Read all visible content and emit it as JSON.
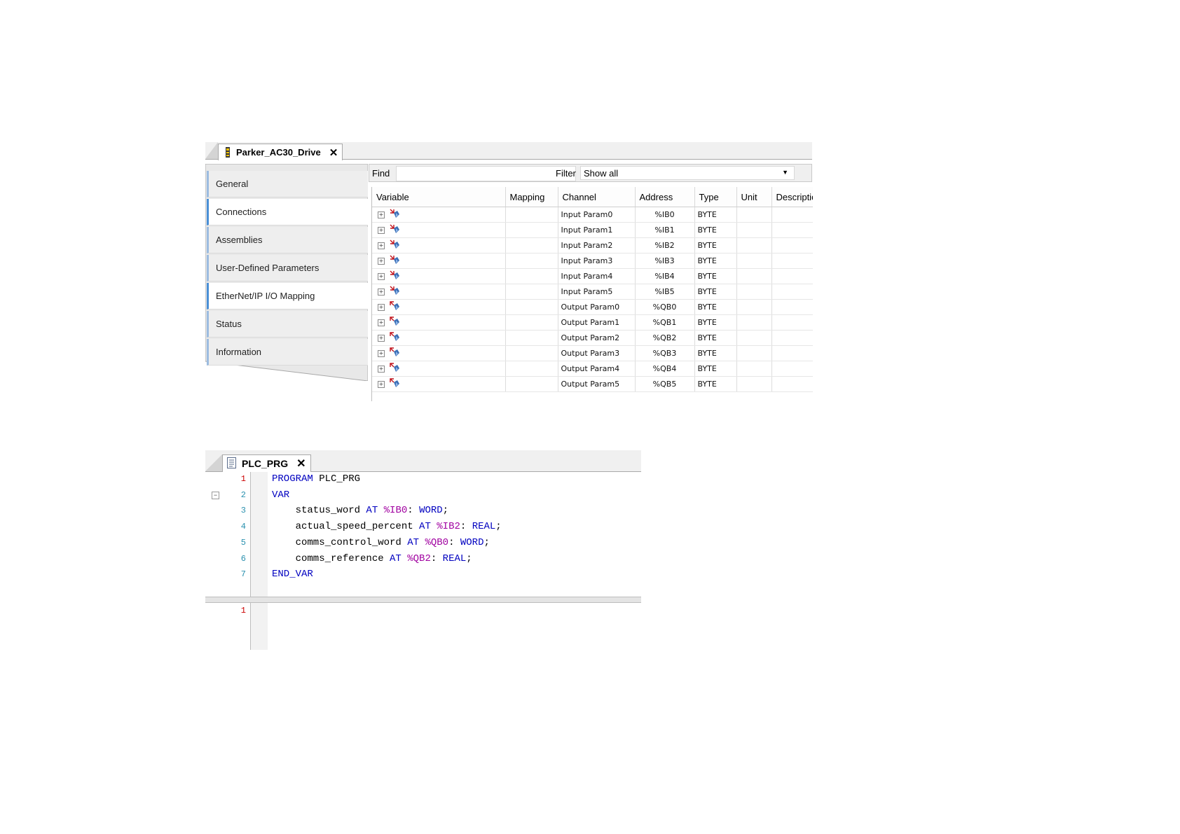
{
  "device_editor": {
    "tab_title": "Parker_AC30_Drive",
    "close_glyph": "✕",
    "nav_items": [
      {
        "label": "General",
        "active": false
      },
      {
        "label": "Connections",
        "active": true
      },
      {
        "label": "Assemblies",
        "active": false
      },
      {
        "label": "User-Defined Parameters",
        "active": false
      },
      {
        "label": "EtherNet/IP I/O Mapping",
        "active": true
      },
      {
        "label": "Status",
        "active": false
      },
      {
        "label": "Information",
        "active": false
      }
    ],
    "find_label": "Find",
    "find_value": "",
    "filter_label": "Filter",
    "filter_value": "Show all",
    "columns": [
      "Variable",
      "Mapping",
      "Channel",
      "Address",
      "Type",
      "Unit",
      "Description"
    ],
    "rows": [
      {
        "channel": "Input Param0",
        "address": "%IB0",
        "type": "BYTE",
        "direction": "input"
      },
      {
        "channel": "Input Param1",
        "address": "%IB1",
        "type": "BYTE",
        "direction": "input"
      },
      {
        "channel": "Input Param2",
        "address": "%IB2",
        "type": "BYTE",
        "direction": "input"
      },
      {
        "channel": "Input Param3",
        "address": "%IB3",
        "type": "BYTE",
        "direction": "input"
      },
      {
        "channel": "Input Param4",
        "address": "%IB4",
        "type": "BYTE",
        "direction": "input"
      },
      {
        "channel": "Input Param5",
        "address": "%IB5",
        "type": "BYTE",
        "direction": "input"
      },
      {
        "channel": "Output Param0",
        "address": "%QB0",
        "type": "BYTE",
        "direction": "output"
      },
      {
        "channel": "Output Param1",
        "address": "%QB1",
        "type": "BYTE",
        "direction": "output"
      },
      {
        "channel": "Output Param2",
        "address": "%QB2",
        "type": "BYTE",
        "direction": "output"
      },
      {
        "channel": "Output Param3",
        "address": "%QB3",
        "type": "BYTE",
        "direction": "output"
      },
      {
        "channel": "Output Param4",
        "address": "%QB4",
        "type": "BYTE",
        "direction": "output"
      },
      {
        "channel": "Output Param5",
        "address": "%QB5",
        "type": "BYTE",
        "direction": "output"
      }
    ]
  },
  "code_editor": {
    "tab_title": "PLC_PRG",
    "close_glyph": "✕",
    "fold_glyph": "−",
    "decl_lines": [
      {
        "n": "1",
        "parts": [
          {
            "t": "PROGRAM",
            "c": "kw"
          },
          {
            "t": " PLC_PRG",
            "c": ""
          }
        ]
      },
      {
        "n": "2",
        "parts": [
          {
            "t": "VAR",
            "c": "kw"
          }
        ]
      },
      {
        "n": "3",
        "parts": [
          {
            "t": "    status_word ",
            "c": ""
          },
          {
            "t": "AT",
            "c": "kw"
          },
          {
            "t": " ",
            "c": ""
          },
          {
            "t": "%IB0",
            "c": "addr"
          },
          {
            "t": ": ",
            "c": ""
          },
          {
            "t": "WORD",
            "c": "kw"
          },
          {
            "t": ";",
            "c": ""
          }
        ]
      },
      {
        "n": "4",
        "parts": [
          {
            "t": "    actual_speed_percent ",
            "c": ""
          },
          {
            "t": "AT",
            "c": "kw"
          },
          {
            "t": " ",
            "c": ""
          },
          {
            "t": "%IB2",
            "c": "addr"
          },
          {
            "t": ": ",
            "c": ""
          },
          {
            "t": "REAL",
            "c": "kw"
          },
          {
            "t": ";",
            "c": ""
          }
        ]
      },
      {
        "n": "5",
        "parts": [
          {
            "t": "    comms_control_word ",
            "c": ""
          },
          {
            "t": "AT",
            "c": "kw"
          },
          {
            "t": " ",
            "c": ""
          },
          {
            "t": "%QB0",
            "c": "addr"
          },
          {
            "t": ": ",
            "c": ""
          },
          {
            "t": "WORD",
            "c": "kw"
          },
          {
            "t": ";",
            "c": ""
          }
        ]
      },
      {
        "n": "6",
        "parts": [
          {
            "t": "    comms_reference ",
            "c": ""
          },
          {
            "t": "AT",
            "c": "kw"
          },
          {
            "t": " ",
            "c": ""
          },
          {
            "t": "%QB2",
            "c": "addr"
          },
          {
            "t": ": ",
            "c": ""
          },
          {
            "t": "REAL",
            "c": "kw"
          },
          {
            "t": ";",
            "c": ""
          }
        ]
      },
      {
        "n": "7",
        "parts": [
          {
            "t": "END_VAR",
            "c": "kw"
          }
        ]
      }
    ],
    "impl_lines": [
      {
        "n": "1"
      }
    ]
  },
  "colors": {
    "keyword": "#0000c0",
    "address": "#a000a0",
    "line_number": "#2b91af",
    "active_accent": "#4a8fd6"
  }
}
